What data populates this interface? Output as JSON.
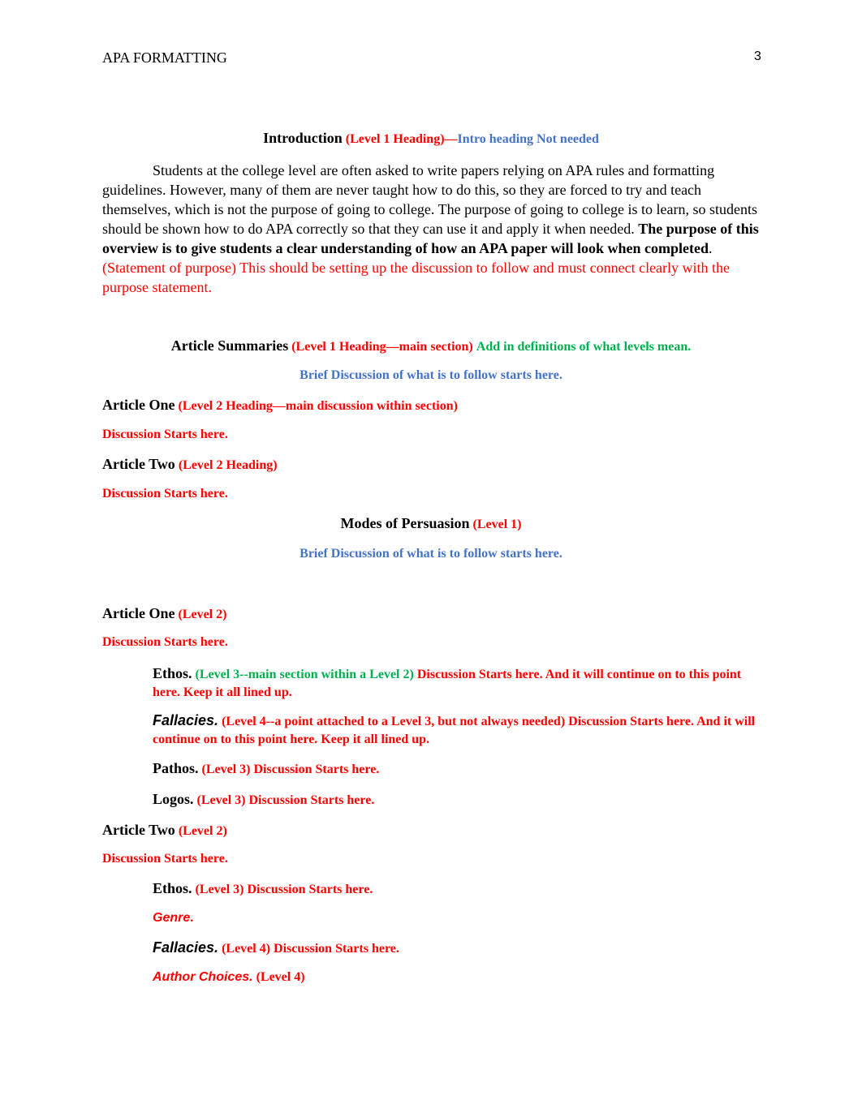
{
  "header": {
    "running_head": "APA FORMATTING",
    "page_number": "3"
  },
  "intro": {
    "heading": "Introduction",
    "note_red": "(Level 1 Heading)—",
    "note_blue": "Intro heading Not needed",
    "paragraph_plain": "Students at the college level are often asked to write papers relying on APA rules and formatting guidelines. However, many of them are never taught how to do this, so they are forced to try and teach themselves, which is not the purpose of going to college. The purpose of going to college is to learn, so students should be shown how to do APA correctly so that they can use it and apply it when needed. ",
    "paragraph_bold": "The purpose of this overview is to give students a clear understanding of how an APA paper will look when completed",
    "paragraph_period": ". ",
    "paragraph_red": "(Statement of purpose) This should be setting up the discussion to follow and must connect clearly with the purpose statement."
  },
  "article_summaries": {
    "heading": "Article Summaries",
    "note_red": "(Level 1 Heading—main section)",
    "note_green": "Add in definitions of what levels mean.",
    "brief": "Brief Discussion of what is to follow starts here.",
    "article_one": {
      "heading": "Article One",
      "note": "(Level 2 Heading—main discussion within section)",
      "discussion": "Discussion Starts here."
    },
    "article_two": {
      "heading": "Article Two",
      "note": "(Level 2 Heading)",
      "discussion": "Discussion Starts here."
    }
  },
  "modes": {
    "heading": "Modes of Persuasion",
    "note": "(Level 1)",
    "brief": "Brief Discussion of what is to follow starts here.",
    "article_one": {
      "heading": "Article One",
      "note": "(Level 2)",
      "discussion": "Discussion Starts here.",
      "ethos": {
        "label": "Ethos.",
        "note_green": "(Level 3--main section within a Level 2)",
        "text": "Discussion Starts here. And it will continue on to this point here. Keep it all lined up."
      },
      "fallacies": {
        "label": "Fallacies.",
        "text": "(Level 4--a point attached to a Level 3, but not always needed) Discussion Starts here. And it will continue on to this point here. Keep it all lined up."
      },
      "pathos": {
        "label": "Pathos.",
        "text": "(Level 3) Discussion Starts here."
      },
      "logos": {
        "label": "Logos.",
        "text": "(Level 3) Discussion Starts here."
      }
    },
    "article_two": {
      "heading": "Article Two",
      "note": "(Level 2)",
      "discussion": "Discussion Starts here.",
      "ethos": {
        "label": "Ethos.",
        "text": "(Level 3) Discussion Starts here."
      },
      "genre": {
        "label": "Genre",
        "period": "."
      },
      "fallacies": {
        "label": "Fallacies.",
        "text": "(Level 4) Discussion Starts here."
      },
      "author_choices": {
        "label": "Author Choices.",
        "text": "(Level 4)"
      }
    }
  },
  "colors": {
    "red": "#ff0000",
    "blue": "#4472c4",
    "green": "#00b050",
    "text": "#000000"
  }
}
